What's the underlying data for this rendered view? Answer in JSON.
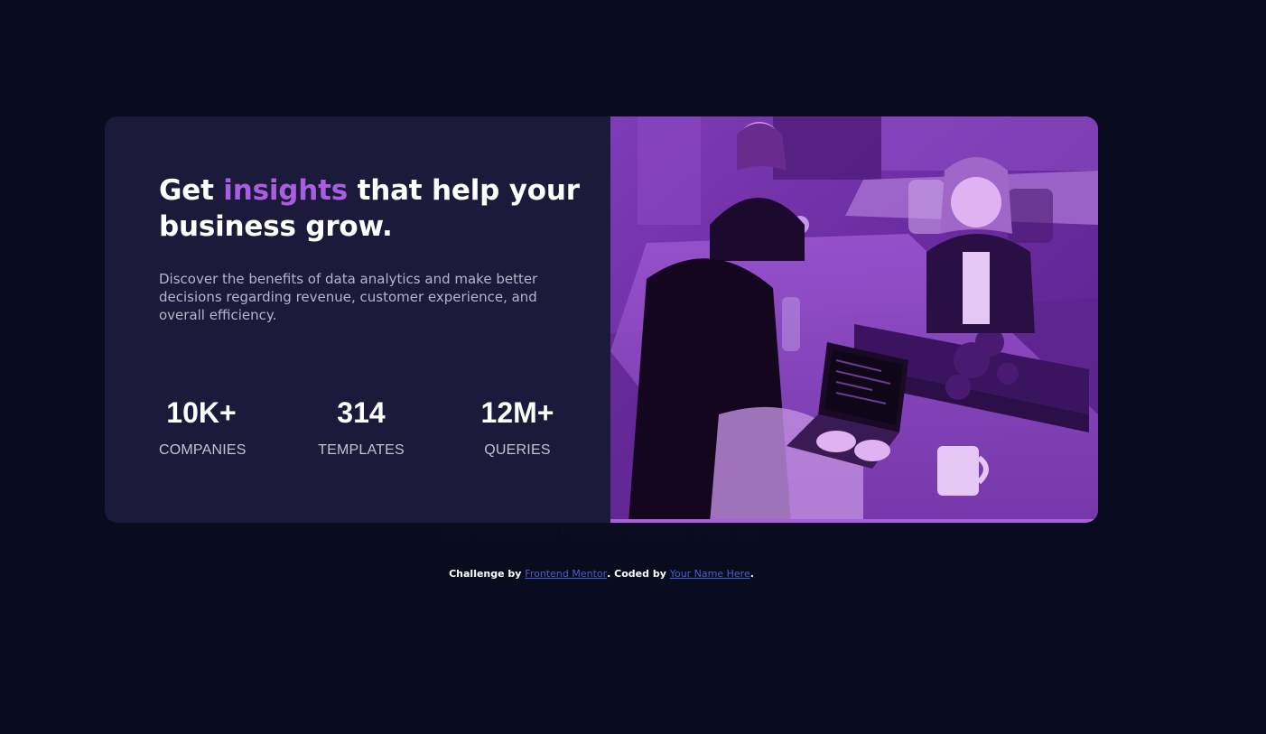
{
  "card": {
    "heading": {
      "before": "Get ",
      "accent": "insights",
      "after": " that help your business grow."
    },
    "description": "Discover the benefits of data analytics and make better decisions regarding revenue, customer experience, and overall efficiency.",
    "stats": [
      {
        "value": "10K+",
        "label": "COMPANIES"
      },
      {
        "value": "314",
        "label": "TEMPLATES"
      },
      {
        "value": "12M+",
        "label": "QUERIES"
      }
    ],
    "image": {
      "icon": "office-team-photo"
    }
  },
  "hidden_caption": "Get insights that help your business grow. 314",
  "attribution": {
    "prefix": "Challenge by ",
    "link1": "Frontend Mentor",
    "middle": ". Coded by ",
    "link2": "Your Name Here",
    "suffix": "."
  },
  "colors": {
    "page_background": "#090b1e",
    "card_background": "#1b1a3b",
    "accent": "#a95ee0",
    "link": "#4c5fc9"
  }
}
